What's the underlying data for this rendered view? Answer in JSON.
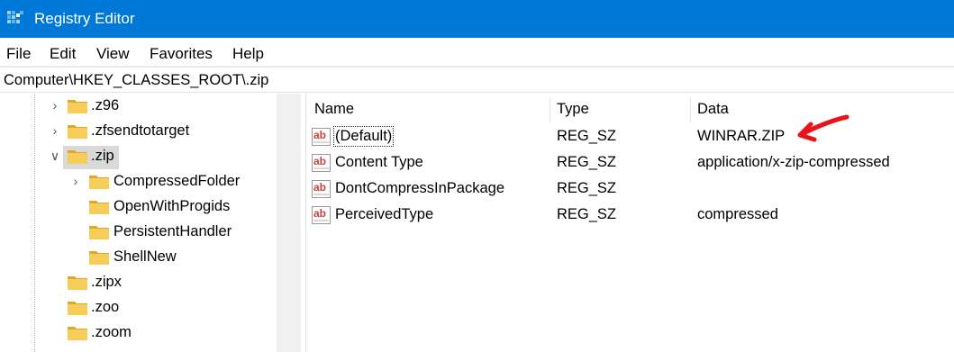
{
  "window": {
    "title": "Registry Editor"
  },
  "menu": [
    "File",
    "Edit",
    "View",
    "Favorites",
    "Help"
  ],
  "address": "Computer\\HKEY_CLASSES_ROOT\\.zip",
  "tree": [
    {
      "label": ".z96",
      "expander": "collapsed",
      "level": 1
    },
    {
      "label": ".zfsendtotarget",
      "expander": "collapsed",
      "level": 1
    },
    {
      "label": ".zip",
      "expander": "expanded",
      "level": 1,
      "selected": true
    },
    {
      "label": "CompressedFolder",
      "expander": "collapsed",
      "level": 2
    },
    {
      "label": "OpenWithProgids",
      "expander": "none",
      "level": 2
    },
    {
      "label": "PersistentHandler",
      "expander": "none",
      "level": 2
    },
    {
      "label": "ShellNew",
      "expander": "none",
      "level": 2
    },
    {
      "label": ".zipx",
      "expander": "none",
      "level": 1
    },
    {
      "label": ".zoo",
      "expander": "none",
      "level": 1
    },
    {
      "label": ".zoom",
      "expander": "none",
      "level": 1
    }
  ],
  "columns": {
    "name": "Name",
    "type": "Type",
    "data": "Data"
  },
  "values": [
    {
      "name": "(Default)",
      "type": "REG_SZ",
      "data": "WINRAR.ZIP",
      "focused": true
    },
    {
      "name": "Content Type",
      "type": "REG_SZ",
      "data": "application/x-zip-compressed"
    },
    {
      "name": "DontCompressInPackage",
      "type": "REG_SZ",
      "data": ""
    },
    {
      "name": "PerceivedType",
      "type": "REG_SZ",
      "data": "compressed"
    }
  ],
  "icons": {
    "app": "registry-editor-icon",
    "folder": "folder-icon",
    "value": "string-value-ab-icon",
    "annotation": "red-arrow-icon"
  },
  "colors": {
    "titlebar": "#0078d7",
    "folder": "#f4c542",
    "selection": "#d9d9d9",
    "annotation": "#e8141c",
    "ab_icon": "#c8433b"
  }
}
